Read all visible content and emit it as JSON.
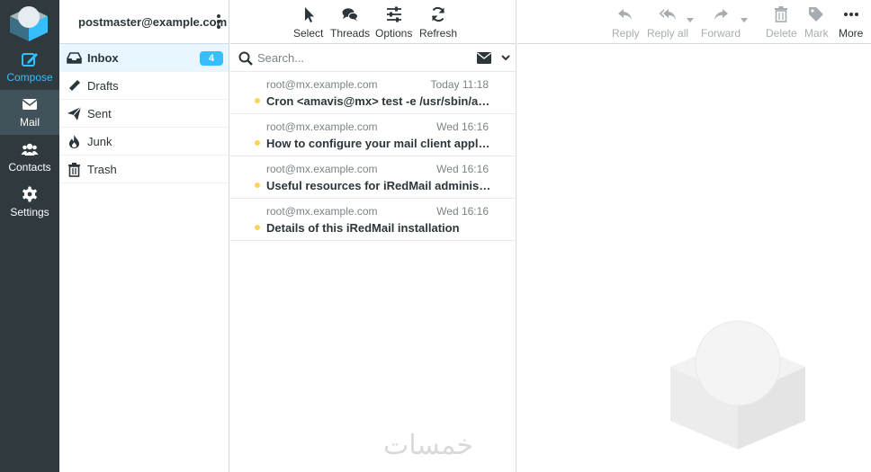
{
  "taskbar": {
    "items": [
      {
        "label": "Compose",
        "icon": "compose-icon"
      },
      {
        "label": "Mail",
        "icon": "envelope-icon"
      },
      {
        "label": "Contacts",
        "icon": "users-icon"
      },
      {
        "label": "Settings",
        "icon": "gear-icon"
      }
    ]
  },
  "account": {
    "email": "postmaster@example.com"
  },
  "folders": [
    {
      "label": "Inbox",
      "unread": "4",
      "icon": "inbox-icon",
      "selected": true
    },
    {
      "label": "Drafts",
      "icon": "pencil-icon"
    },
    {
      "label": "Sent",
      "icon": "paper-plane-icon"
    },
    {
      "label": "Junk",
      "icon": "fire-icon"
    },
    {
      "label": "Trash",
      "icon": "trash-icon"
    }
  ],
  "list_toolbar": {
    "select": "Select",
    "threads": "Threads",
    "options": "Options",
    "refresh": "Refresh"
  },
  "search": {
    "placeholder": "Search..."
  },
  "messages": [
    {
      "from": "root@mx.example.com",
      "date": "Today 11:18",
      "subject": "Cron <amavis@mx> test -e /usr/sbin/amavisd-new-cronjob"
    },
    {
      "from": "root@mx.example.com",
      "date": "Wed 16:16",
      "subject": "How to configure your mail client applications"
    },
    {
      "from": "root@mx.example.com",
      "date": "Wed 16:16",
      "subject": "Useful resources for iRedMail administrator"
    },
    {
      "from": "root@mx.example.com",
      "date": "Wed 16:16",
      "subject": "Details of this iRedMail installation"
    }
  ],
  "message_toolbar": {
    "reply": "Reply",
    "reply_all": "Reply all",
    "forward": "Forward",
    "delete": "Delete",
    "mark": "Mark",
    "more": "More"
  },
  "watermark": "خمسات",
  "colors": {
    "accent": "#37beff",
    "taskbar": "#2f3a3f",
    "unread_dot": "#ffd452"
  }
}
